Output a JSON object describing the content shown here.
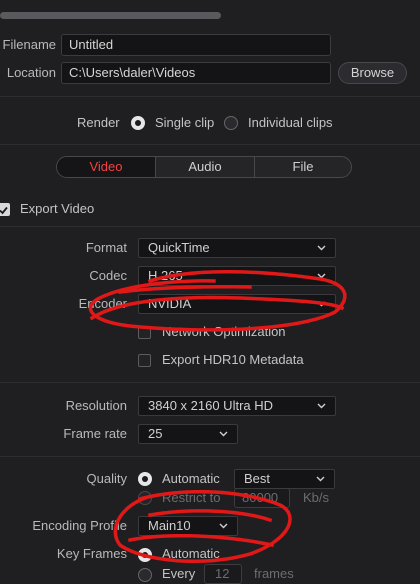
{
  "file": {
    "filename_label": "Filename",
    "filename_value": "Untitled",
    "location_label": "Location",
    "location_value": "C:\\Users\\daler\\Videos",
    "browse_label": "Browse"
  },
  "render": {
    "label": "Render",
    "options": [
      "Single clip",
      "Individual clips"
    ],
    "selected": "Single clip"
  },
  "tabs": [
    {
      "label": "Video",
      "active": true
    },
    {
      "label": "Audio",
      "active": false
    },
    {
      "label": "File",
      "active": false
    }
  ],
  "video": {
    "export_video_label": "Export Video",
    "export_video_checked": true,
    "format_label": "Format",
    "format_value": "QuickTime",
    "codec_label": "Codec",
    "codec_value": "H.265",
    "encoder_label": "Encoder",
    "encoder_value": "NVIDIA",
    "network_opt_label": "Network Optimization",
    "hdr_label": "Export HDR10 Metadata",
    "resolution_label": "Resolution",
    "resolution_value": "3840 x 2160 Ultra HD",
    "framerate_label": "Frame rate",
    "framerate_value": "25",
    "quality_label": "Quality",
    "quality_auto_label": "Automatic",
    "quality_auto_value": "Best",
    "restrict_label": "Restrict to",
    "restrict_value": "80000",
    "restrict_unit": "Kb/s",
    "encoding_profile_label": "Encoding Profile",
    "encoding_profile_value": "Main10",
    "key_frames_label": "Key Frames",
    "key_frames_auto_label": "Automatic",
    "every_label": "Every",
    "every_value": "12",
    "frames_label": "frames"
  },
  "colors": {
    "background": "#1f1f22",
    "active_tab": "#ef4343",
    "scribble": "#e01818"
  }
}
